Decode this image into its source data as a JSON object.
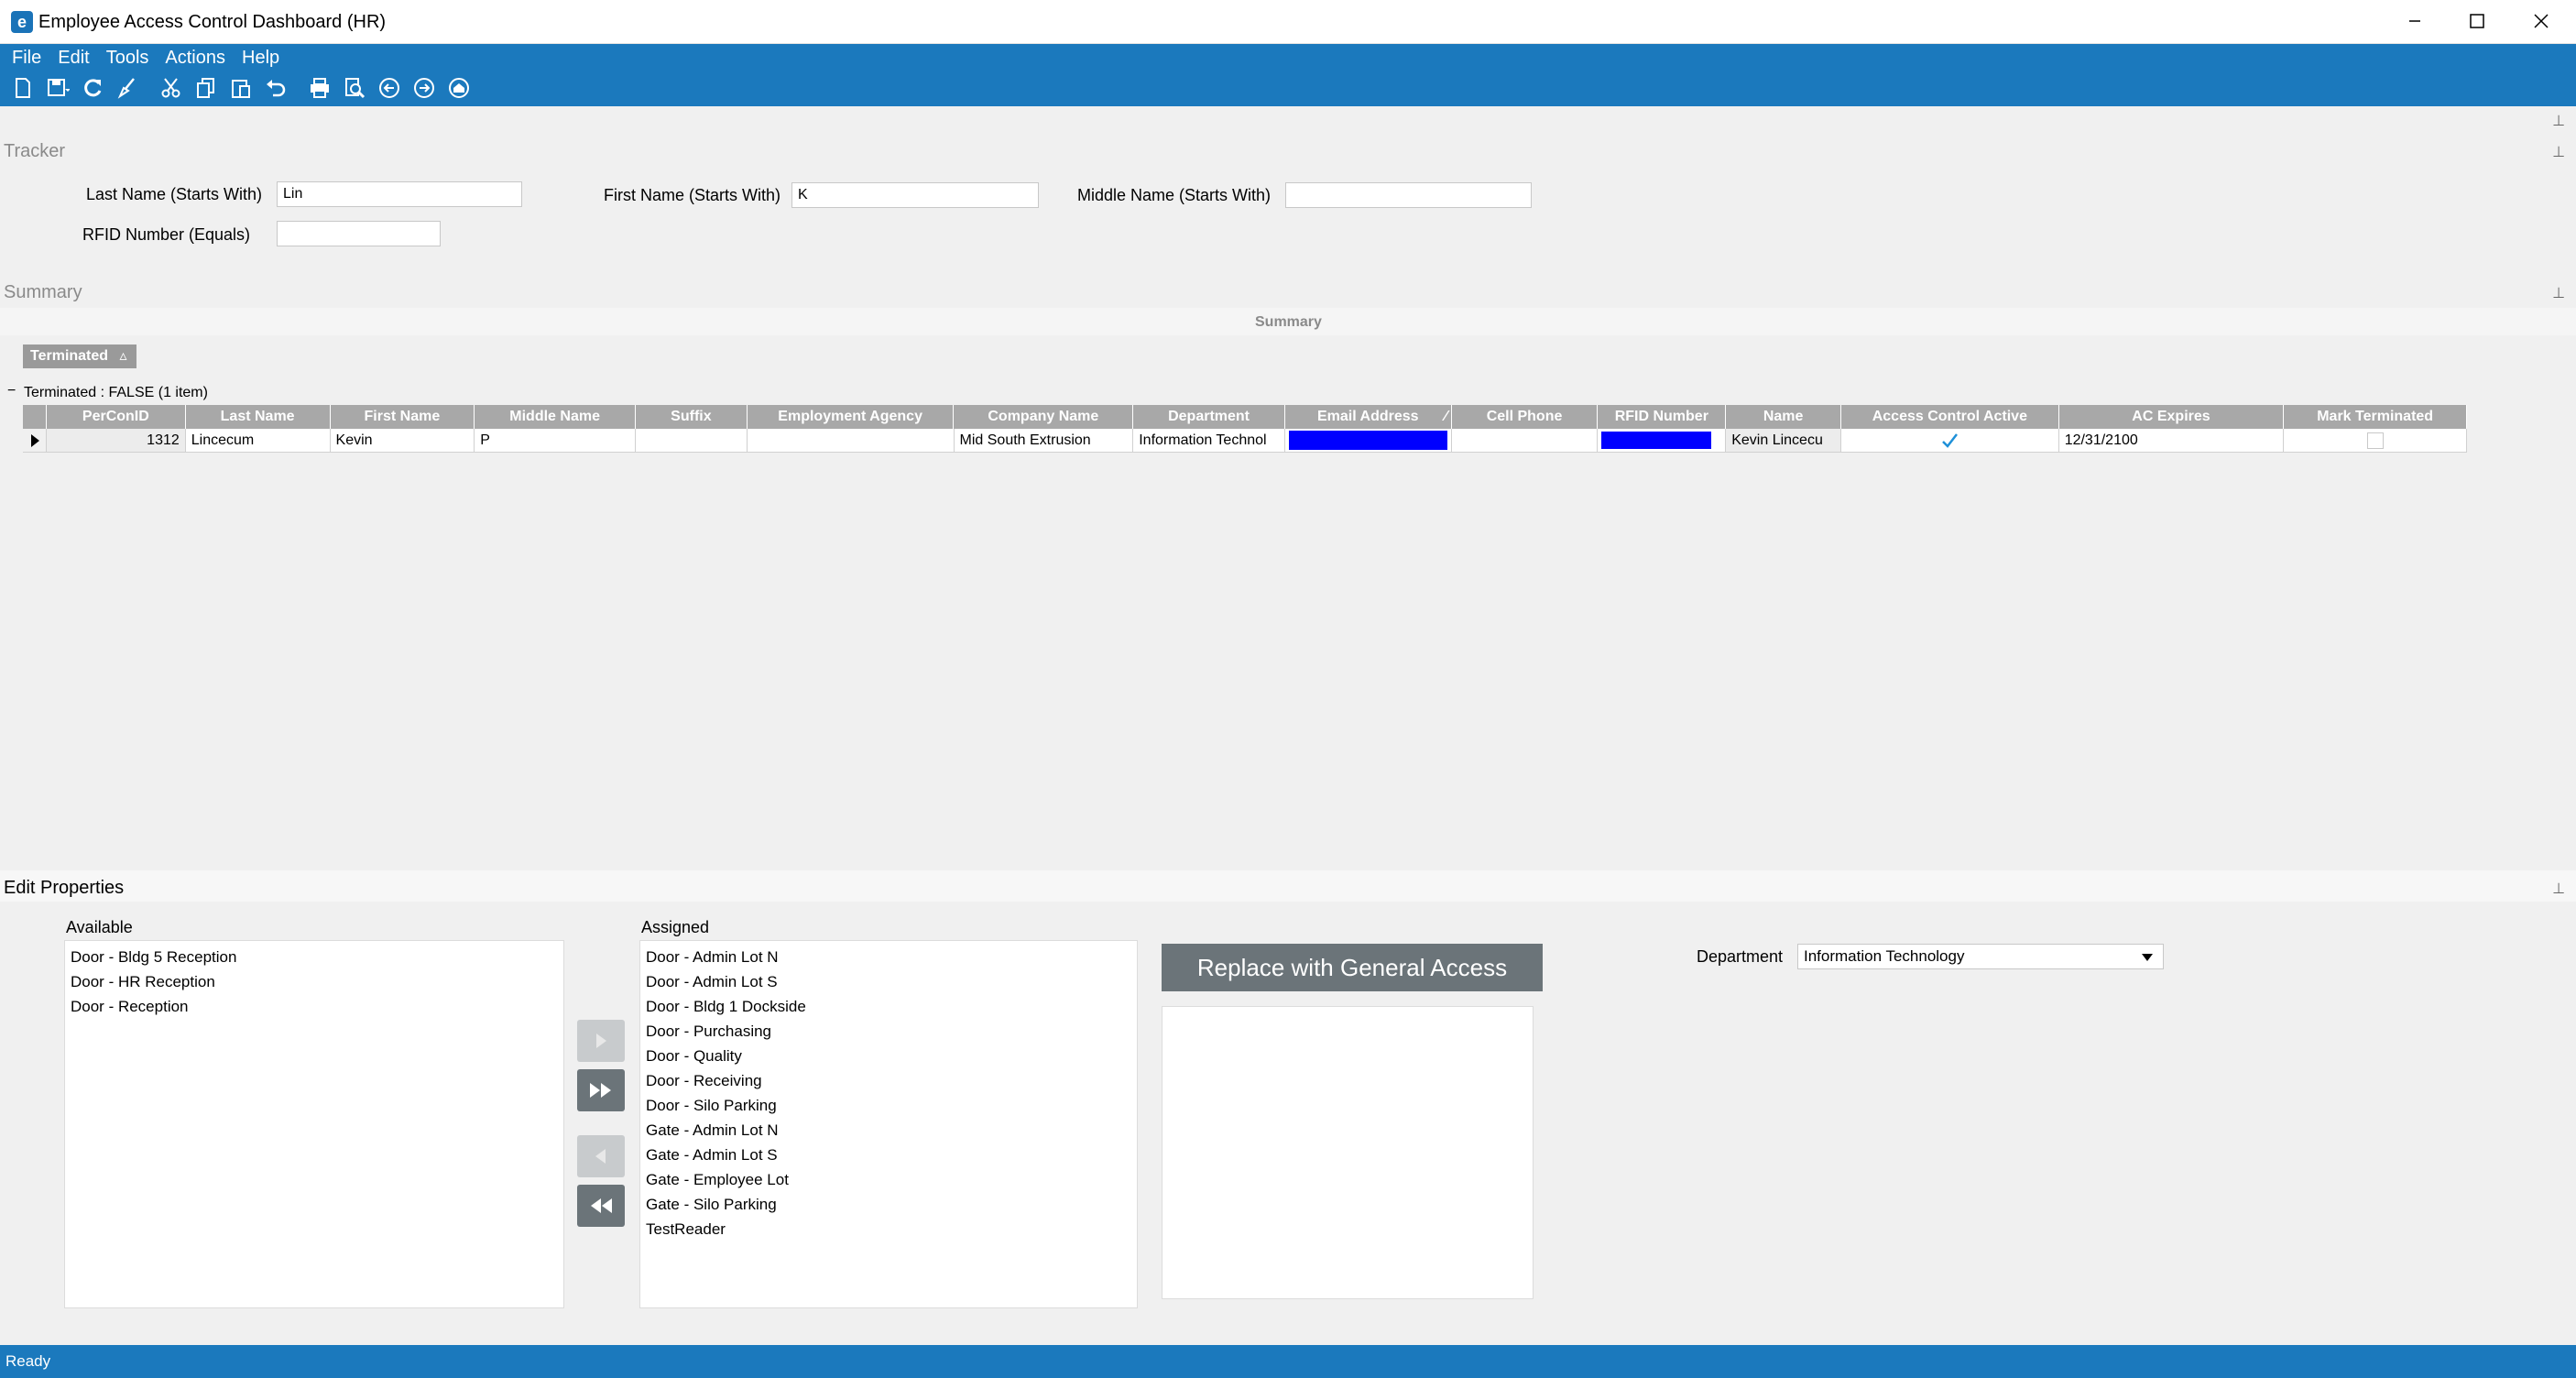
{
  "window": {
    "title": "Employee Access Control Dashboard (HR)",
    "app_icon": "e"
  },
  "menu": [
    "File",
    "Edit",
    "Tools",
    "Actions",
    "Help"
  ],
  "toolbar": [
    "new-icon",
    "save-icon",
    "refresh-icon",
    "clear-icon",
    "cut-icon",
    "copy-icon",
    "paste-icon",
    "undo-icon",
    "print-icon",
    "print-preview-icon",
    "back-icon",
    "forward-icon",
    "home-icon"
  ],
  "tracker": {
    "title": "Tracker",
    "last_name_label": "Last Name (Starts With)",
    "last_name_value": "Lin",
    "first_name_label": "First Name (Starts With)",
    "first_name_value": "K",
    "middle_name_label": "Middle Name (Starts With)",
    "middle_name_value": "",
    "rfid_label": "RFID Number (Equals)",
    "rfid_value": ""
  },
  "summary": {
    "title": "Summary",
    "caption": "Summary",
    "group_chip": "Terminated",
    "group_sort_glyph": "▵",
    "collapse_glyph": "−",
    "group_row": "Terminated : FALSE (1 item)",
    "sort_glyph": "⁄",
    "columns": [
      "PerConID",
      "Last Name",
      "First Name",
      "Middle Name",
      "Suffix",
      "Employment Agency",
      "Company Name",
      "Department",
      "Email Address",
      "Cell Phone",
      "RFID Number",
      "Name",
      "Access Control Active",
      "AC Expires",
      "Mark Terminated"
    ],
    "row": {
      "perconid": "1312",
      "last_name": "Lincecum",
      "first_name": "Kevin",
      "middle_name": "P",
      "suffix": "",
      "agency": "",
      "company": "Mid South Extrusion",
      "department": "Information Technol",
      "cell_phone": "",
      "name": "Kevin Lincecu",
      "ac_active": true,
      "ac_expires": "12/31/2100",
      "mark_terminated": false
    },
    "redaction_color": "#0000ff"
  },
  "edit": {
    "title": "Edit Properties",
    "available_label": "Available",
    "available": [
      "Door - Bldg 5 Reception",
      "Door - HR Reception",
      "Door - Reception"
    ],
    "assigned_label": "Assigned",
    "assigned": [
      "Door - Admin Lot N",
      "Door - Admin Lot S",
      "Door - Bldg 1 Dockside",
      "Door - Purchasing",
      "Door - Quality",
      "Door - Receiving",
      "Door - Silo Parking",
      "Gate - Admin Lot N",
      "Gate - Admin Lot S",
      "Gate - Employee Lot",
      "Gate - Silo Parking",
      "TestReader"
    ],
    "replace_button": "Replace with General Access",
    "department_label": "Department",
    "department_value": "Information Technology"
  },
  "status": {
    "text": "Ready"
  },
  "colors": {
    "accent": "#1b79bd",
    "header_gray": "#a8a8a8",
    "button_gray": "#6b7479"
  }
}
